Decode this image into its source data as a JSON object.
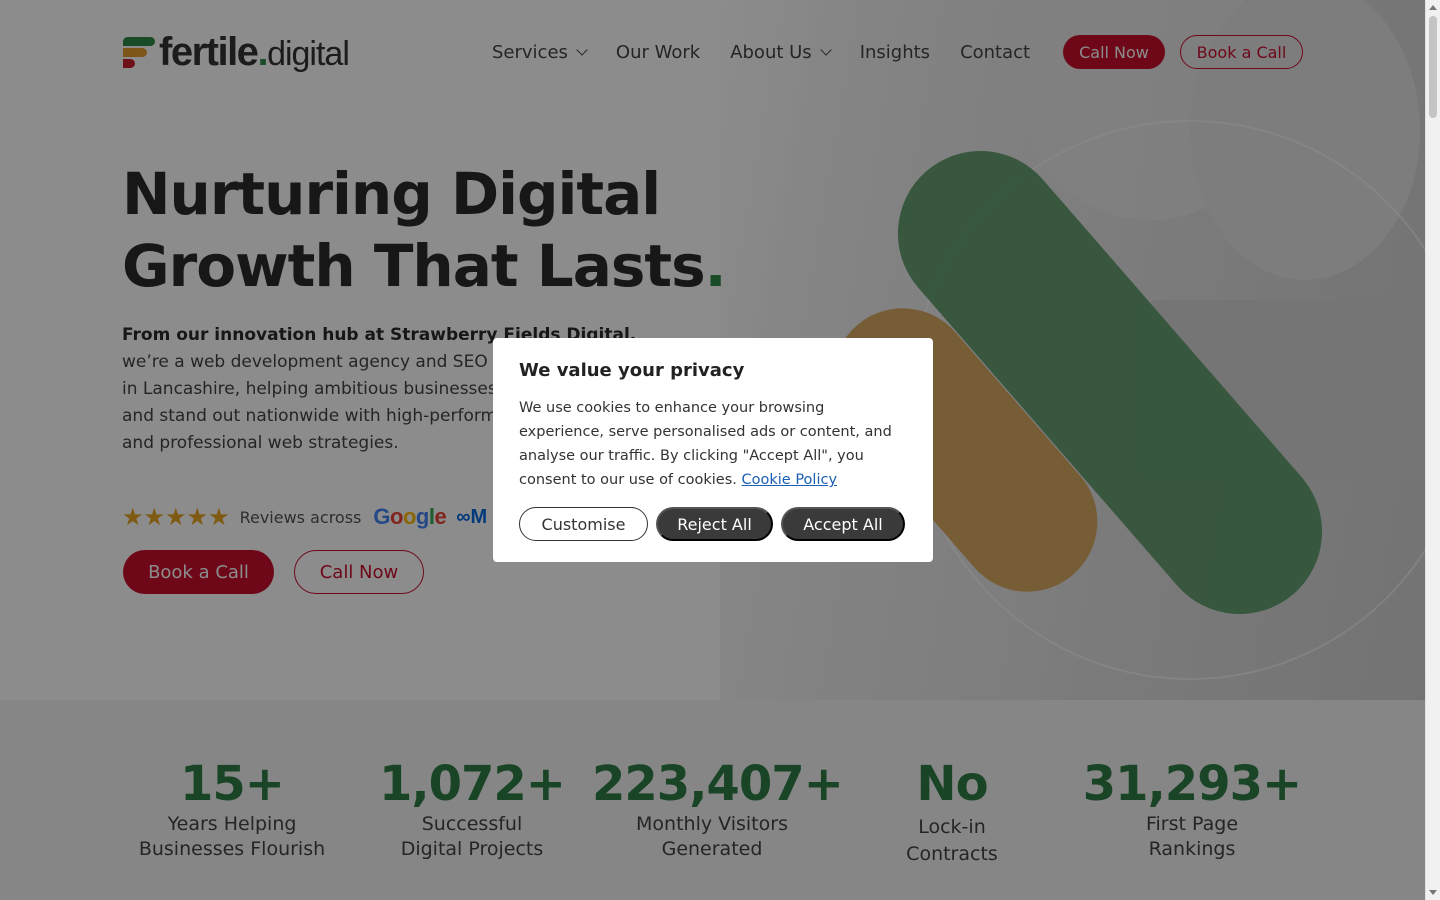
{
  "brand": {
    "name": "fertile",
    "dot": ".",
    "suffix": "digital"
  },
  "nav": {
    "items": [
      {
        "label": "Services",
        "has_dropdown": true
      },
      {
        "label": "Our Work",
        "has_dropdown": false
      },
      {
        "label": "About Us",
        "has_dropdown": true
      },
      {
        "label": "Insights",
        "has_dropdown": false
      },
      {
        "label": "Contact",
        "has_dropdown": false
      }
    ],
    "call_label": "Call Now",
    "book_label": "Book a Call"
  },
  "hero": {
    "title_line1": "Nurturing Digital",
    "title_line2": "Growth That Lasts",
    "title_dot": ".",
    "lead_bold": "From our innovation hub at Strawberry Fields Digital,",
    "lead_rest": "we’re a web development agency and SEO company based in Lancashire, helping ambitious businesses grow, thrive, and stand out nationwide with high-performance websites and professional web strategies.",
    "reviews_text": "Reviews across",
    "review_stars": 5,
    "review_platforms": [
      "Google",
      "Meta"
    ],
    "book_label": "Book a Call",
    "call_label": "Call Now"
  },
  "stats": [
    {
      "number": "15+",
      "label_line1": "Years Helping",
      "label_line2": "Businesses Flourish"
    },
    {
      "number": "1,072+",
      "label_line1": "Successful",
      "label_line2": "Digital Projects"
    },
    {
      "number": "223,407+",
      "label_line1": "Monthly Visitors",
      "label_line2": "Generated"
    },
    {
      "number": "No",
      "label_line1": "Lock-in",
      "label_line2": "Contracts"
    },
    {
      "number": "31,293+",
      "label_line1": "First Page",
      "label_line2": "Rankings"
    }
  ],
  "cookie": {
    "title": "We value your privacy",
    "text": "We use cookies to enhance your browsing experience, serve personalised ads or content, and analyse our traffic. By clicking \"Accept All\", you consent to our use of cookies.",
    "link": "Cookie Policy",
    "customise": "Customise",
    "reject": "Reject All",
    "accept": "Accept All"
  },
  "colors": {
    "brand_red": "#c8102e",
    "brand_green": "#2e7d45",
    "brand_orange": "#e39b2e",
    "star": "#e7a522",
    "overlay": "rgba(0,0,0,0.45)"
  },
  "icons": [
    "chevron-down-icon",
    "star-icon",
    "google-logo",
    "meta-logo",
    "logo-mark-icon"
  ]
}
